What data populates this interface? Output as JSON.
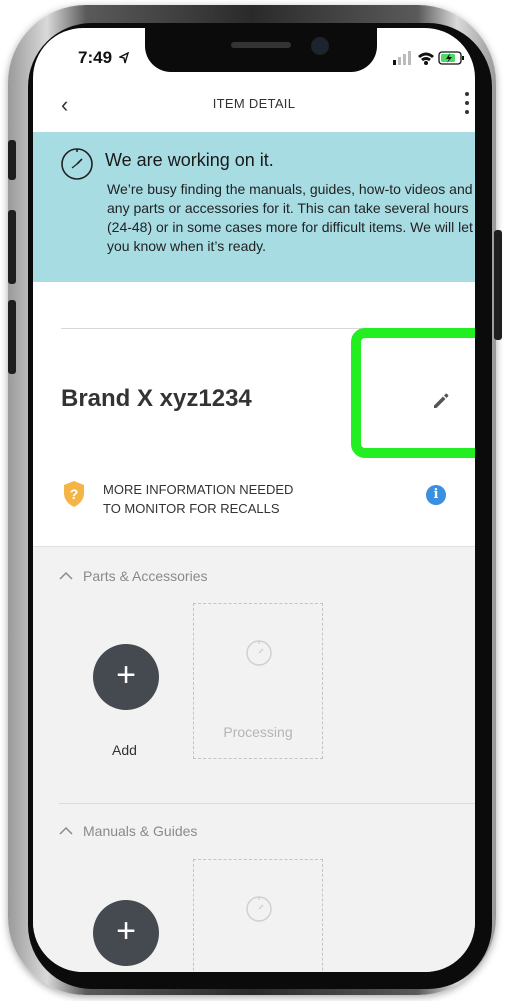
{
  "status_bar": {
    "time": "7:49"
  },
  "header": {
    "back_label": "‹",
    "title": "ITEM DETAIL"
  },
  "banner": {
    "title": "We are working on it.",
    "text": "We’re busy finding the manuals, guides, how-to videos and any parts or accessories for it. This can take several hours (24-48) or in some cases more for difficult items. We will let you know when it’s ready."
  },
  "item": {
    "name": "Brand X xyz1234"
  },
  "recall": {
    "line1": "MORE INFORMATION NEEDED",
    "line2": "TO MONITOR FOR RECALLS",
    "info_glyph": "i"
  },
  "sections": {
    "parts": {
      "header": "Parts & Accessories",
      "add_label": "Add",
      "add_glyph": "+",
      "card_label": "Processing"
    },
    "manuals": {
      "header": "Manuals & Guides",
      "add_glyph": "+"
    }
  },
  "colors": {
    "banner_bg": "#a8dce3",
    "highlight": "#22ee22",
    "info_blue": "#3a8fe0",
    "shield_orange": "#f5b546",
    "add_button": "#454a50"
  }
}
